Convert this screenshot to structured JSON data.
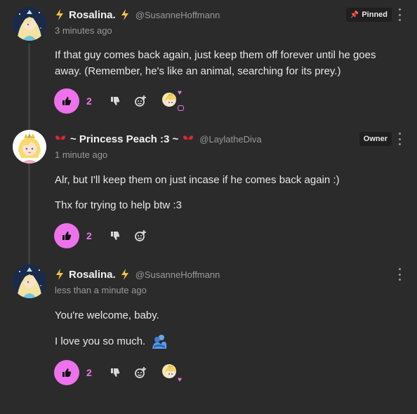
{
  "comments": [
    {
      "display_name": "Rosalina.",
      "handle": "@SusanneHoffmann",
      "time": "3 minutes ago",
      "badge": "Pinned",
      "paragraphs": [
        "If that guy comes back again, just keep them off forever until he goes away. (Remember, he's like an animal, searching for its prey.)"
      ],
      "likes": "2",
      "flair_icon": "lightning-icon",
      "has_reaction": true
    },
    {
      "display_name": "~ Princess Peach :3 ~",
      "handle": "@LaylatheDiva",
      "time": "1 minute ago",
      "badge": "Owner",
      "paragraphs": [
        "Alr, but I'll keep them on just incase if he comes back again :)",
        "Thx for trying to help btw :3"
      ],
      "likes": "2",
      "flair_icon": "ribbon-icon",
      "has_reaction": false
    },
    {
      "display_name": "Rosalina.",
      "handle": "@SusanneHoffmann",
      "time": "less than a minute ago",
      "badge": "",
      "paragraphs": [
        "You're welcome, baby.",
        "I love you so much."
      ],
      "likes": "2",
      "flair_icon": "lightning-icon",
      "has_reaction": true
    }
  ],
  "colors": {
    "background": "#2b2b2b",
    "accent": "#ee72ec",
    "muted": "#9a9a9a",
    "text": "#e8e8e8"
  }
}
